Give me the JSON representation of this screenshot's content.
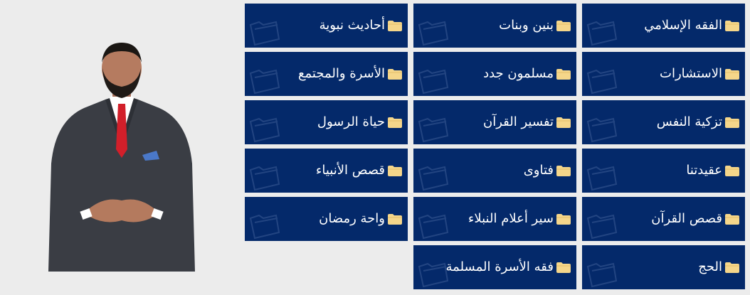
{
  "categories": {
    "col_right": [
      {
        "label": "الفقه الإسلامي"
      },
      {
        "label": "الاستشارات"
      },
      {
        "label": "تزكية النفس"
      },
      {
        "label": "عقيدتنا"
      },
      {
        "label": "قصص القرآن"
      },
      {
        "label": "الحج"
      }
    ],
    "col_middle": [
      {
        "label": "بنين وبنات"
      },
      {
        "label": "مسلمون جدد"
      },
      {
        "label": "تفسير القرآن"
      },
      {
        "label": "فتاوى"
      },
      {
        "label": "سير أعلام النبلاء"
      },
      {
        "label": "فقه الأسرة المسلمة"
      }
    ],
    "col_left": [
      {
        "label": "أحاديث نبوية"
      },
      {
        "label": "الأسرة والمجتمع"
      },
      {
        "label": "حياة الرسول"
      },
      {
        "label": "قصص الأنبياء"
      },
      {
        "label": "واحة رمضان"
      }
    ]
  },
  "icons": {
    "tile_icon": "folder-icon",
    "watermark_icon": "folder-outline-icon"
  },
  "colors": {
    "tile_bg": "#04296a",
    "folder": "#f5d68a",
    "page_bg": "#ececec"
  }
}
